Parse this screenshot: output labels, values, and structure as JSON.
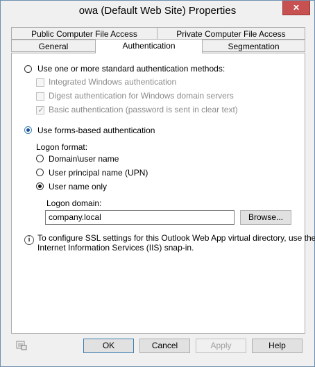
{
  "window": {
    "title": "owa (Default Web Site) Properties",
    "close_glyph": "✕"
  },
  "tabs": {
    "row1": [
      "Public Computer File Access",
      "Private Computer File Access"
    ],
    "row2": [
      "General",
      "Authentication",
      "Segmentation"
    ],
    "active": "Authentication"
  },
  "auth": {
    "standard_option": "Use one or more standard authentication methods:",
    "integrated": "Integrated Windows authentication",
    "digest": "Digest authentication for Windows domain servers",
    "basic": "Basic authentication (password is sent in clear text)",
    "forms_option": "Use forms-based authentication",
    "logon_format_label": "Logon format:",
    "formats": [
      "Domain\\user name",
      "User principal name (UPN)",
      "User name only"
    ],
    "selected_format": "User name only",
    "logon_domain_label": "Logon domain:",
    "logon_domain_value": "company.local",
    "browse_label": "Browse...",
    "info_text_line1": "To configure SSL settings for this Outlook Web App virtual directory, use the",
    "info_text_line2": "Internet Information Services (IIS) snap-in."
  },
  "footer": {
    "ok": "OK",
    "cancel": "Cancel",
    "apply": "Apply",
    "help": "Help"
  }
}
